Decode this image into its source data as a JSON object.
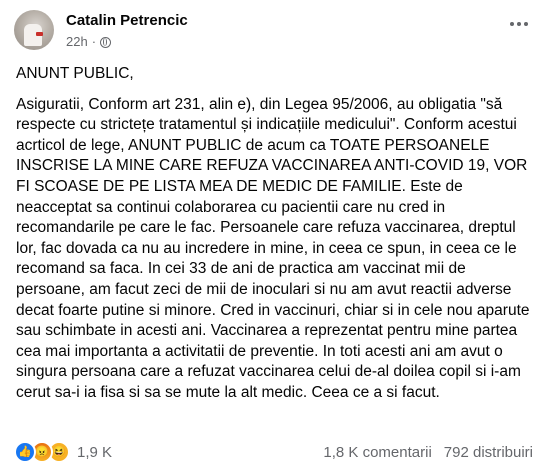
{
  "author": {
    "name": "Catalin Petrencic",
    "time": "22h",
    "separator": "·",
    "audience_icon": "globe-icon"
  },
  "post": {
    "heading": "ANUNT PUBLIC,",
    "body": "Asiguratii, Conform art 231, alin e), din Legea 95/2006, au obligatia \"să respecte cu strictețe tratamentul și indicațiile medicului\". Conform acestui acrticol de lege, ANUNT PUBLIC de acum ca TOATE PERSOANELE INSCRISE LA MINE CARE REFUZA VACCINAREA ANTI-COVID 19, VOR FI SCOASE DE PE LISTA MEA DE MEDIC DE FAMILIE. Este de neacceptat sa continui colaborarea cu pacientii care nu cred in recomandarile pe care le fac. Persoanele care refuza vaccinarea, dreptul lor, fac dovada ca nu au incredere in mine, in ceea ce spun, in ceea ce le recomand sa faca. In cei 33 de ani de practica am vaccinat mii de persoane, am facut zeci de mii de inoculari si nu am avut reactii adverse decat foarte putine si minore. Cred in vaccinuri, chiar si in cele nou aparute sau schimbate in acesti ani. Vaccinarea a reprezentat pentru mine partea cea mai importanta a activitatii de preventie. In toti acesti ani am avut o singura persoana care a refuzat vaccinarea celui de-al doilea copil si i-am cerut sa-i ia fisa si sa se mute la alt medic. Ceea ce a si facut."
  },
  "footer": {
    "reaction_icons": [
      "like-icon",
      "angry-icon",
      "haha-icon"
    ],
    "reaction_count": "1,9 K",
    "comments": "1,8 K comentarii",
    "shares": "792 distribuiri"
  },
  "colors": {
    "like": "#1877f2",
    "reaction_yellow": "#f7b125",
    "secondary_text": "#65676b"
  }
}
